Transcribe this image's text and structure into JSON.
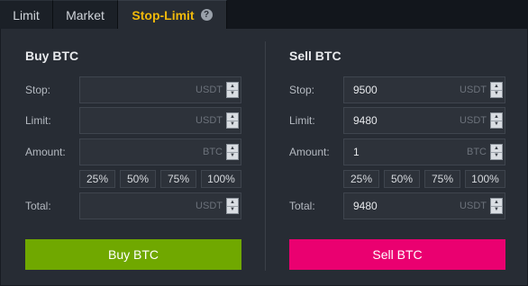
{
  "tabs": [
    {
      "label": "Limit"
    },
    {
      "label": "Market"
    },
    {
      "label": "Stop-Limit",
      "help": "?"
    }
  ],
  "buy": {
    "title": "Buy BTC",
    "stop": {
      "label": "Stop:",
      "value": "",
      "unit": "USDT"
    },
    "limit": {
      "label": "Limit:",
      "value": "",
      "unit": "USDT"
    },
    "amount": {
      "label": "Amount:",
      "value": "",
      "unit": "BTC"
    },
    "percents": [
      "25%",
      "50%",
      "75%",
      "100%"
    ],
    "total": {
      "label": "Total:",
      "value": "",
      "unit": "USDT"
    },
    "button": "Buy BTC"
  },
  "sell": {
    "title": "Sell BTC",
    "stop": {
      "label": "Stop:",
      "value": "9500",
      "unit": "USDT"
    },
    "limit": {
      "label": "Limit:",
      "value": "9480",
      "unit": "USDT"
    },
    "amount": {
      "label": "Amount:",
      "value": "1",
      "unit": "BTC"
    },
    "percents": [
      "25%",
      "50%",
      "75%",
      "100%"
    ],
    "total": {
      "label": "Total:",
      "value": "9480",
      "unit": "USDT"
    },
    "button": "Sell BTC"
  },
  "colors": {
    "accent": "#f0b90b",
    "buy": "#70a800",
    "sell": "#ea0070",
    "panel": "#272c34"
  },
  "icons": {
    "spinner_up": "▲",
    "spinner_down": "▼"
  }
}
